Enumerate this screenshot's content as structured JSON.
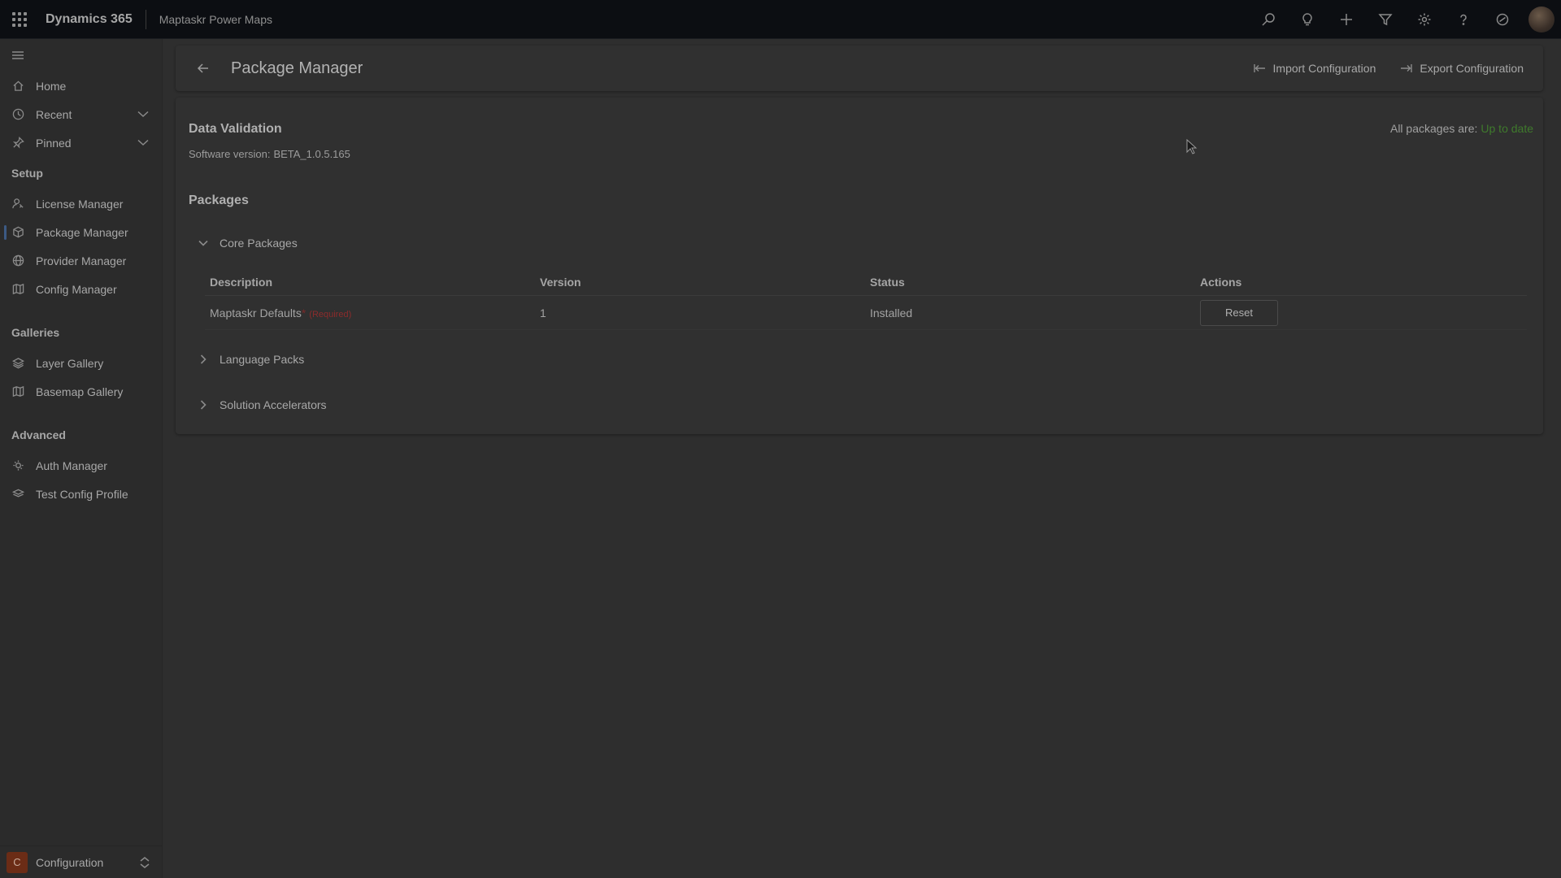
{
  "topbar": {
    "brand": "Dynamics 365",
    "app_name": "Maptaskr Power Maps",
    "icons": [
      "search-icon",
      "lightbulb-icon",
      "add-icon",
      "filter-icon",
      "settings-icon",
      "help-icon",
      "copilot-icon"
    ]
  },
  "sidebar": {
    "top_items": [
      {
        "label": "Home",
        "icon": "home-icon"
      },
      {
        "label": "Recent",
        "icon": "clock-icon"
      },
      {
        "label": "Pinned",
        "icon": "pin-icon"
      }
    ],
    "groups": [
      {
        "title": "Setup",
        "items": [
          {
            "label": "License Manager",
            "icon": "license-icon"
          },
          {
            "label": "Package Manager",
            "icon": "package-icon",
            "active": true
          },
          {
            "label": "Provider Manager",
            "icon": "globe-icon"
          },
          {
            "label": "Config Manager",
            "icon": "map-icon"
          }
        ]
      },
      {
        "title": "Galleries",
        "items": [
          {
            "label": "Layer Gallery",
            "icon": "layers-icon"
          },
          {
            "label": "Basemap Gallery",
            "icon": "map-icon"
          }
        ]
      },
      {
        "title": "Advanced",
        "items": [
          {
            "label": "Auth Manager",
            "icon": "auth-icon"
          },
          {
            "label": "Test Config Profile",
            "icon": "layers-stack-icon"
          }
        ]
      }
    ],
    "footer": {
      "badge": "C",
      "label": "Configuration"
    }
  },
  "commandbar": {
    "title": "Package Manager",
    "import_label": "Import Configuration",
    "export_label": "Export Configuration"
  },
  "content": {
    "data_validation_title": "Data Validation",
    "software_version_label": "Software version:",
    "software_version": "BETA_1.0.5.165",
    "all_packages_label": "All packages are:",
    "all_packages_status": "Up to date",
    "status_color": "#3f7a2c",
    "packages_title": "Packages",
    "sections": {
      "core": "Core Packages",
      "language": "Language Packs",
      "accelerators": "Solution Accelerators"
    },
    "table": {
      "headers": [
        "Description",
        "Version",
        "Status",
        "Actions"
      ],
      "rows": [
        {
          "description": "Maptaskr Defaults",
          "required_mark": "*",
          "required_text": "(Required)",
          "version": "1",
          "status": "Installed",
          "action": "Reset"
        }
      ]
    }
  }
}
